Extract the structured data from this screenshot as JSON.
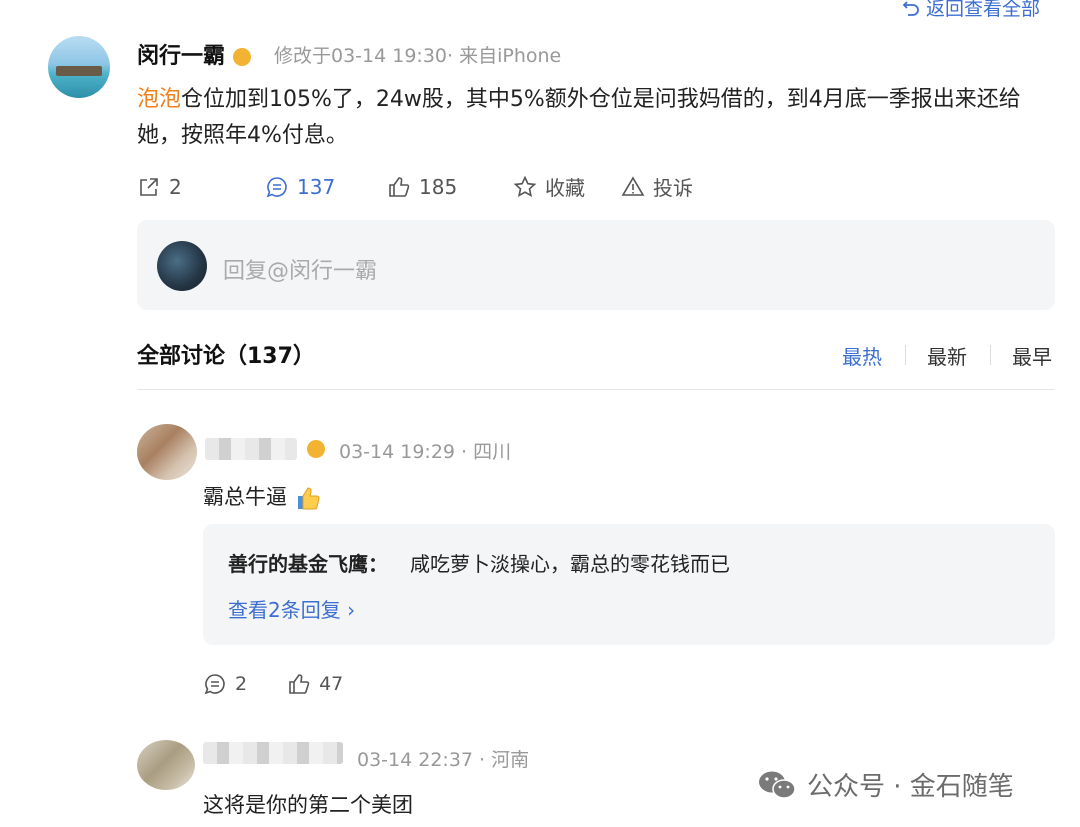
{
  "header": {
    "back_label": "返回查看全部"
  },
  "post": {
    "author": "闵行一霸",
    "meta": "修改于03-14 19:30· 来自iPhone",
    "mention": "泡泡",
    "text": "仓位加到105%了，24w股，其中5%额外仓位是问我妈借的，到4月底一季报出来还给她，按照年4%付息。",
    "actions": {
      "repost": "2",
      "comment": "137",
      "like": "185",
      "favorite": "收藏",
      "report": "投诉"
    }
  },
  "reply_box": {
    "placeholder": "回复@闵行一霸"
  },
  "discussion": {
    "title": "全部讨论（137）",
    "sort": [
      "最热",
      "最新",
      "最早"
    ],
    "active_sort": "最热"
  },
  "comments": [
    {
      "meta": "03-14 19:29 · 四川",
      "text": "霸总牛逼",
      "quote": {
        "author": "善行的基金飞鹰",
        "separator": "：",
        "text": "咸吃萝卜淡操心，霸总的零花钱而已",
        "more": "查看2条回复 ›"
      },
      "replies": "2",
      "likes": "47"
    },
    {
      "meta": "03-14 22:37 · 河南",
      "text": "这将是你的第二个美团"
    }
  ],
  "watermark": {
    "text": "公众号 · 金石随笔"
  },
  "colors": {
    "accent": "#3d6fd1",
    "mention": "#f0801c",
    "muted": "#999999",
    "panel": "#f4f5f7"
  }
}
